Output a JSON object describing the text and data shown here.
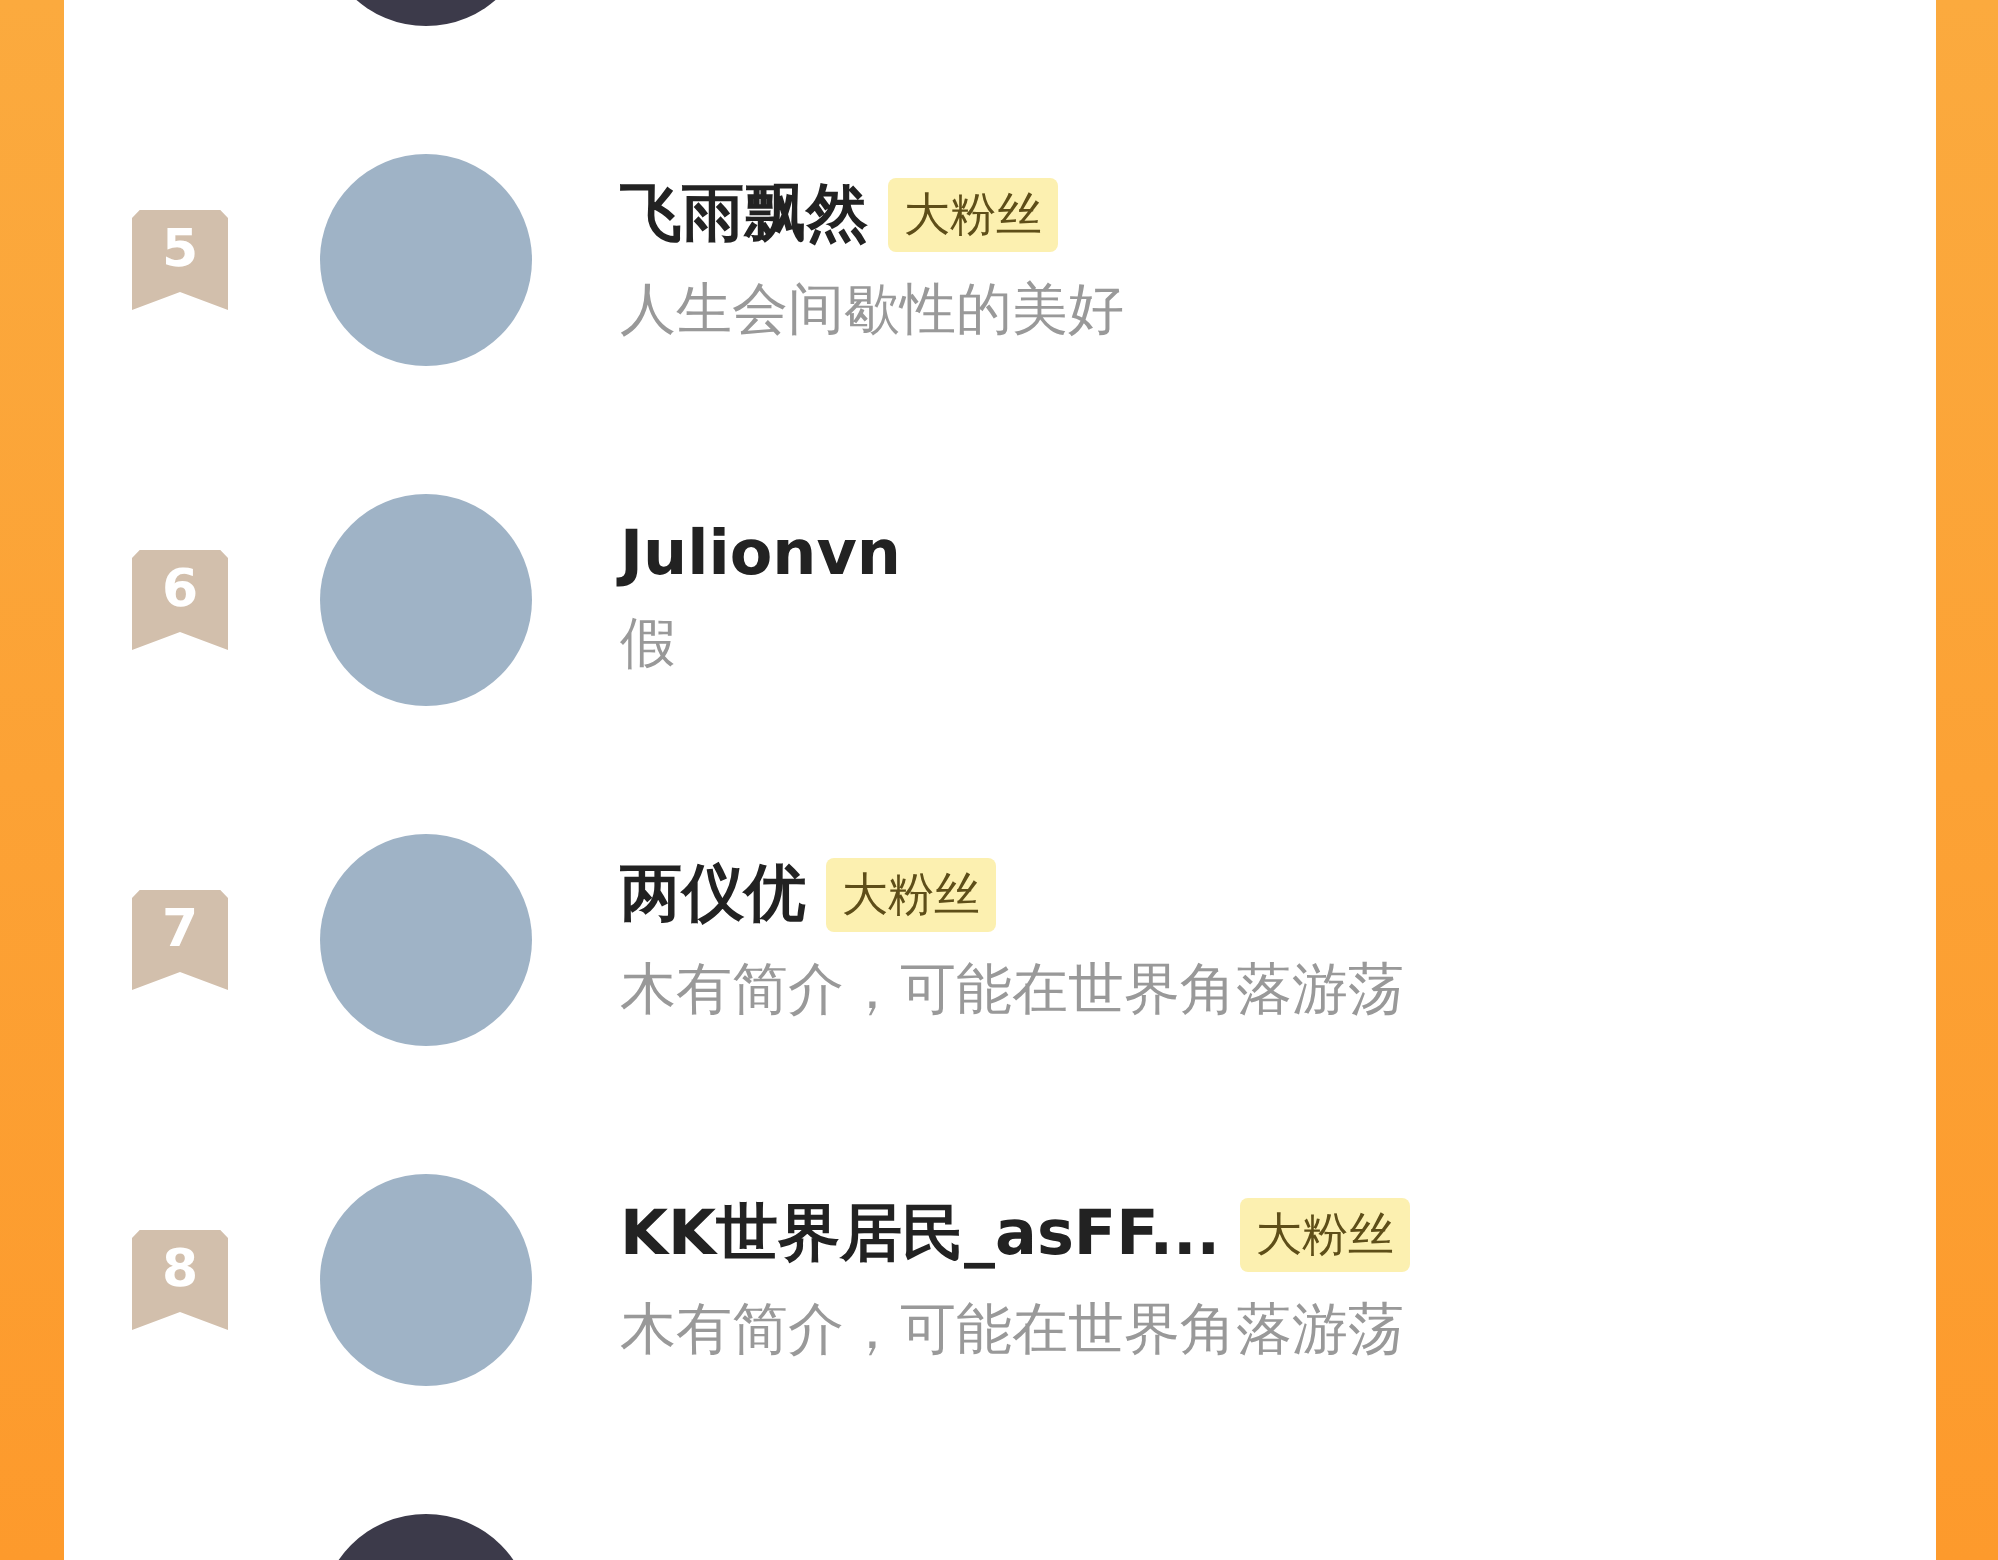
{
  "fans": [
    {
      "rank": "5",
      "name": "飞雨飘然",
      "badge": "大粉丝",
      "bio": "人生会间歇性的美好"
    },
    {
      "rank": "6",
      "name": "Julionvn",
      "bio": "假"
    },
    {
      "rank": "7",
      "name": "两仪优",
      "badge": "大粉丝",
      "bio": "木有简介，可能在世界角落游荡"
    },
    {
      "rank": "8",
      "name": "KK世界居民_asFF...",
      "badge": "大粉丝",
      "bio": "木有简介，可能在世界角落游荡"
    }
  ]
}
